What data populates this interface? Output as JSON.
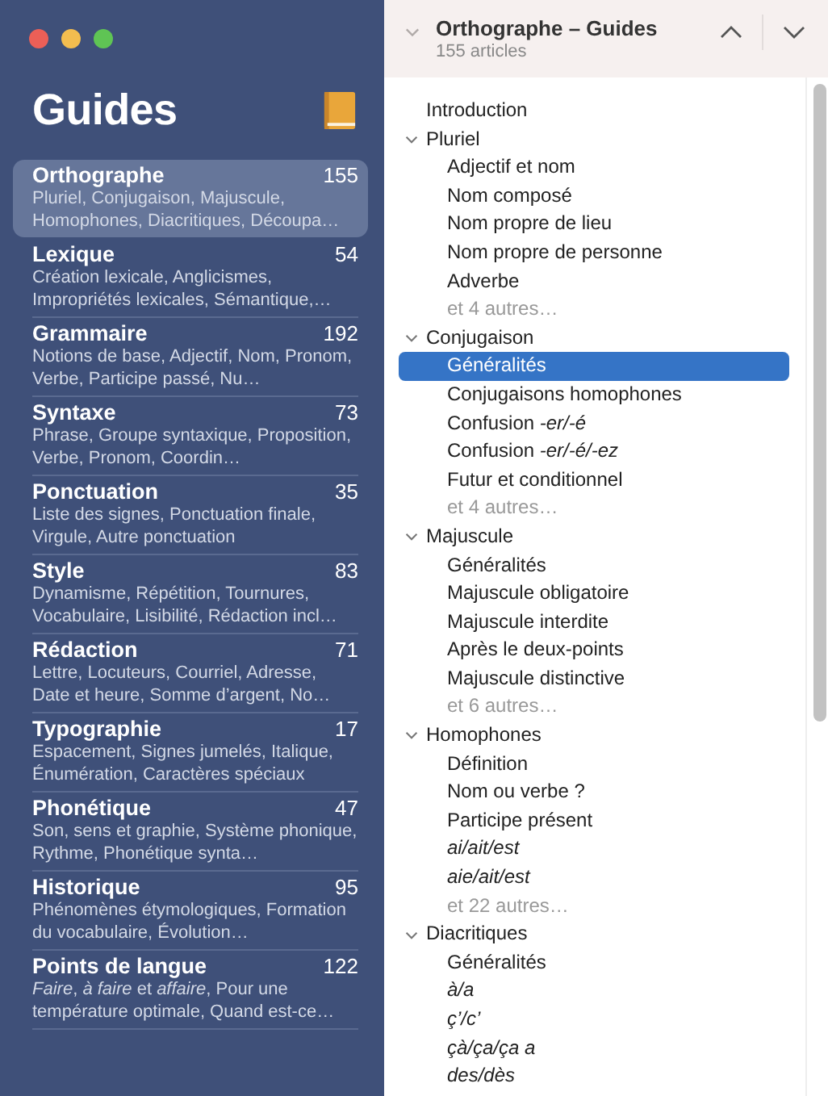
{
  "window": {
    "traffic_lights": [
      {
        "color": "#ec5f57"
      },
      {
        "color": "#f3bd4f"
      },
      {
        "color": "#5fc454"
      }
    ]
  },
  "sidebar": {
    "title": "Guides",
    "items": [
      {
        "name": "Orthographe",
        "count": "155",
        "summary": "Pluriel, Conjugaison, Majuscule, Homophones, Diacritiques, Découpa…",
        "selected": true
      },
      {
        "name": "Lexique",
        "count": "54",
        "summary": "Création lexicale, Anglicismes, Impropriétés lexicales, Sémantique,…",
        "selected": false
      },
      {
        "name": "Grammaire",
        "count": "192",
        "summary": "Notions de base, Adjectif, Nom, Pronom, Verbe, Participe passé, Nu…",
        "selected": false
      },
      {
        "name": "Syntaxe",
        "count": "73",
        "summary": "Phrase, Groupe syntaxique, Proposition, Verbe, Pronom, Coordin…",
        "selected": false
      },
      {
        "name": "Ponctuation",
        "count": "35",
        "summary": "Liste des signes, Ponctuation finale, Virgule, Autre ponctuation",
        "selected": false
      },
      {
        "name": "Style",
        "count": "83",
        "summary": "Dynamisme, Répétition, Tournures, Vocabulaire, Lisibilité, Rédaction incl…",
        "selected": false
      },
      {
        "name": "Rédaction",
        "count": "71",
        "summary": "Lettre, Locuteurs, Courriel, Adresse, Date et heure, Somme d’argent, No…",
        "selected": false
      },
      {
        "name": "Typographie",
        "count": "17",
        "summary": "Espacement, Signes jumelés, Italique, Énumération, Caractères spéciaux",
        "selected": false
      },
      {
        "name": "Phonétique",
        "count": "47",
        "summary": "Son, sens et graphie, Système phonique, Rythme, Phonétique synta…",
        "selected": false
      },
      {
        "name": "Historique",
        "count": "95",
        "summary": "Phénomènes étymologiques, Formation du vocabulaire, Évolution…",
        "selected": false
      },
      {
        "name": "Points de langue",
        "count": "122",
        "summary": "*Faire*, *à faire* et *affaire*, Pour une température optimale, Quand est-ce…",
        "selected": false
      }
    ]
  },
  "detail": {
    "title": "Orthographe – Guides",
    "subtitle": "155 articles",
    "tree": [
      {
        "label": "Introduction",
        "kind": "article",
        "selected": false
      },
      {
        "label": "Pluriel",
        "kind": "section",
        "expanded": true,
        "children": [
          {
            "label": "Adjectif et nom",
            "kind": "article",
            "selected": false
          },
          {
            "label": "Nom composé",
            "kind": "article",
            "selected": false
          },
          {
            "label": "Nom propre de lieu",
            "kind": "article",
            "selected": false
          },
          {
            "label": "Nom propre de personne",
            "kind": "article",
            "selected": false
          },
          {
            "label": "Adverbe",
            "kind": "article",
            "selected": false
          },
          {
            "label": "et 4 autres…",
            "kind": "more"
          }
        ]
      },
      {
        "label": "Conjugaison",
        "kind": "section",
        "expanded": true,
        "children": [
          {
            "label": "Généralités",
            "kind": "article",
            "selected": true
          },
          {
            "label": "Conjugaisons homophones",
            "kind": "article",
            "selected": false
          },
          {
            "label": "Confusion *-er/-é*",
            "kind": "article",
            "selected": false
          },
          {
            "label": "Confusion *-er/-é/-ez*",
            "kind": "article",
            "selected": false
          },
          {
            "label": "Futur et conditionnel",
            "kind": "article",
            "selected": false
          },
          {
            "label": "et 4 autres…",
            "kind": "more"
          }
        ]
      },
      {
        "label": "Majuscule",
        "kind": "section",
        "expanded": true,
        "children": [
          {
            "label": "Généralités",
            "kind": "article",
            "selected": false
          },
          {
            "label": "Majuscule obligatoire",
            "kind": "article",
            "selected": false
          },
          {
            "label": "Majuscule interdite",
            "kind": "article",
            "selected": false
          },
          {
            "label": "Après le deux-points",
            "kind": "article",
            "selected": false
          },
          {
            "label": "Majuscule distinctive",
            "kind": "article",
            "selected": false
          },
          {
            "label": "et 6 autres…",
            "kind": "more"
          }
        ]
      },
      {
        "label": "Homophones",
        "kind": "section",
        "expanded": true,
        "children": [
          {
            "label": "Définition",
            "kind": "article",
            "selected": false
          },
          {
            "label": "Nom ou verbe ?",
            "kind": "article",
            "selected": false
          },
          {
            "label": "Participe présent",
            "kind": "article",
            "selected": false
          },
          {
            "label": "ai/ait/est",
            "kind": "article",
            "italic": true,
            "selected": false
          },
          {
            "label": "aie/ait/est",
            "kind": "article",
            "italic": true,
            "selected": false
          },
          {
            "label": "et 22 autres…",
            "kind": "more"
          }
        ]
      },
      {
        "label": "Diacritiques",
        "kind": "section",
        "expanded": true,
        "children": [
          {
            "label": "Généralités",
            "kind": "article",
            "selected": false
          },
          {
            "label": "à/a",
            "kind": "article",
            "italic": true,
            "selected": false
          },
          {
            "label": "ç’/c’",
            "kind": "article",
            "italic": true,
            "selected": false
          },
          {
            "label": "çà/ça/ça a",
            "kind": "article",
            "italic": true,
            "selected": false
          },
          {
            "label": "des/dès",
            "kind": "article",
            "italic": true,
            "selected": false
          }
        ]
      }
    ]
  }
}
